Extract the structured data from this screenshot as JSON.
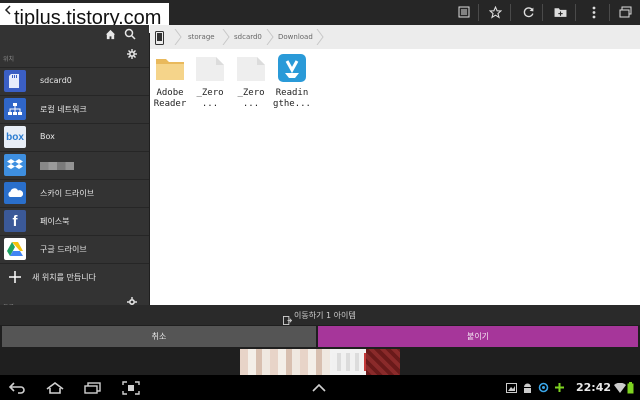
{
  "watermark": "tiplus.tistory.com",
  "actionbar": {
    "icons": [
      "list-icon",
      "star-icon",
      "refresh-icon",
      "new-folder-icon",
      "overflow-menu-icon",
      "windows-icon"
    ]
  },
  "sidebar": {
    "header_top": "위치",
    "header_bottom": "도구",
    "items": [
      {
        "label": "sdcard0",
        "icon": "sdcard-icon",
        "color": "#3b5fc4"
      },
      {
        "label": "로컬 네트워크",
        "icon": "network-icon",
        "color": "#2f66c9"
      },
      {
        "label": "Box",
        "icon": "box-icon",
        "color": "#e8eef7"
      },
      {
        "label": "",
        "icon": "dropbox-icon",
        "color": "#3e8fe0"
      },
      {
        "label": "스카이 드라이브",
        "icon": "skydrive-icon",
        "color": "#2a6fcb"
      },
      {
        "label": "페이스북",
        "icon": "facebook-icon",
        "color": "#3b5998"
      },
      {
        "label": "구글 드라이브",
        "icon": "google-drive-icon",
        "color": "#ffffff"
      },
      {
        "label": "새 위치를 만듭니다",
        "icon": "plus-icon",
        "color": "#333333"
      }
    ]
  },
  "breadcrumb": {
    "crumbs": [
      "storage",
      "sdcard0",
      "Download"
    ]
  },
  "files": [
    {
      "name_line1": "Adobe",
      "name_line2": "Reader",
      "type": "folder"
    },
    {
      "name_line1": "_Zero",
      "name_line2": "...",
      "type": "blank"
    },
    {
      "name_line1": "_Zero",
      "name_line2": "...",
      "type": "blank"
    },
    {
      "name_line1": "Readin",
      "name_line2": "gthe...",
      "type": "app"
    }
  ],
  "bottom": {
    "move_label": "이동하기 1 아이템",
    "cancel_label": "취소",
    "paste_label": "붙이기"
  },
  "status": {
    "clock": "22:42"
  },
  "colors": {
    "accent": "#a6369a",
    "sidebar_bg": "#333333",
    "content_bg": "#ffffff"
  }
}
